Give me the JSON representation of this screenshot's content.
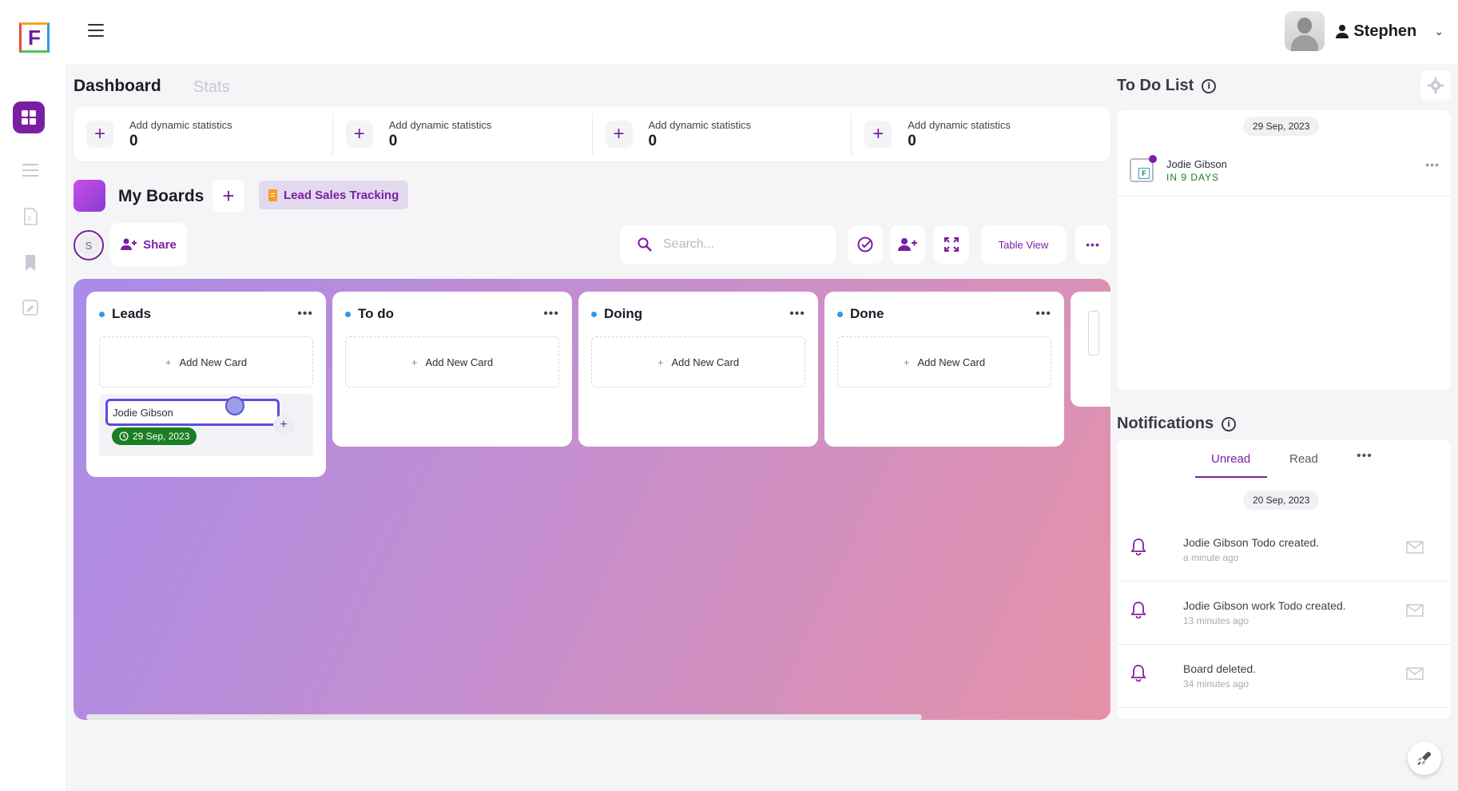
{
  "app": {
    "logo_letter": "F"
  },
  "header": {
    "user_name": "Stephen"
  },
  "tabs": {
    "dashboard": "Dashboard",
    "stats": "Stats"
  },
  "stats": [
    {
      "label": "Add dynamic statistics",
      "value": "0"
    },
    {
      "label": "Add dynamic statistics",
      "value": "0"
    },
    {
      "label": "Add dynamic statistics",
      "value": "0"
    },
    {
      "label": "Add dynamic statistics",
      "value": "0"
    }
  ],
  "boards": {
    "title": "My Boards",
    "active_board": "Lead Sales Tracking",
    "member_initial": "S",
    "share_label": "Share",
    "search_placeholder": "Search...",
    "view_label": "Table View"
  },
  "columns": [
    {
      "title": "Leads",
      "add_label": "Add New Card"
    },
    {
      "title": "To do",
      "add_label": "Add New Card"
    },
    {
      "title": "Doing",
      "add_label": "Add New Card"
    },
    {
      "title": "Done",
      "add_label": "Add New Card"
    }
  ],
  "card": {
    "name": "Jodie Gibson",
    "due_date": "29 Sep, 2023"
  },
  "todo": {
    "title": "To Do List",
    "date": "29 Sep, 2023",
    "item": {
      "name": "Jodie Gibson",
      "due": "IN 9 DAYS"
    }
  },
  "notifications": {
    "title": "Notifications",
    "tabs": {
      "unread": "Unread",
      "read": "Read"
    },
    "date": "20 Sep, 2023",
    "items": [
      {
        "text": "Jodie Gibson Todo created.",
        "time": "a minute ago"
      },
      {
        "text": "Jodie Gibson work Todo created.",
        "time": "13 minutes ago"
      },
      {
        "text": "Board deleted.",
        "time": "34 minutes ago"
      }
    ]
  },
  "colors": {
    "accent": "#7b1fa2",
    "due_green": "#1a7f23",
    "dot_blue": "#2b9be8"
  }
}
